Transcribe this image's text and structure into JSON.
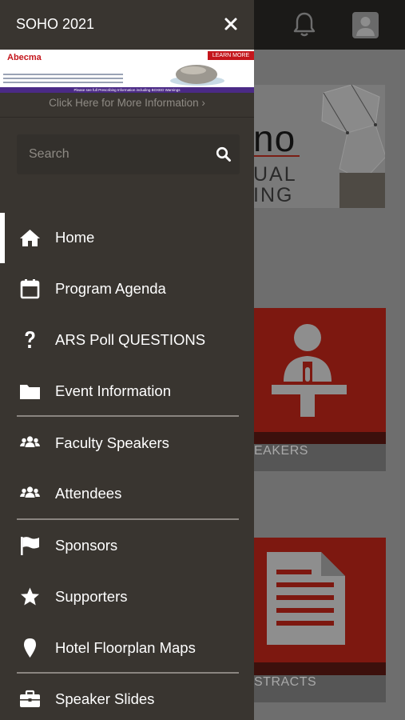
{
  "app_title": "SOHO 2021",
  "ad": {
    "brand": "Abecma",
    "cta": "LEARN MORE",
    "more_info": "Click Here for More Information ›",
    "footer": "Please see full Prescribing Information including BOXED Warnings"
  },
  "search": {
    "placeholder": "Search",
    "value": ""
  },
  "menu": [
    {
      "label": "Home",
      "icon": "home-icon",
      "active": true
    },
    {
      "label": "Program Agenda",
      "icon": "calendar-icon"
    },
    {
      "label": "ARS Poll QUESTIONS",
      "icon": "question-icon"
    },
    {
      "label": "Event Information",
      "icon": "folder-icon"
    },
    {
      "label": "Faculty Speakers",
      "icon": "users-icon"
    },
    {
      "label": "Attendees",
      "icon": "users-icon"
    },
    {
      "label": "Sponsors",
      "icon": "flag-icon"
    },
    {
      "label": "Supporters",
      "icon": "star-icon"
    },
    {
      "label": "Hotel Floorplan Maps",
      "icon": "map-pin-icon"
    },
    {
      "label": "Speaker Slides",
      "icon": "briefcase-icon"
    }
  ],
  "background": {
    "banner_title": "no",
    "banner_line1": "UAL",
    "banner_line2": "ING",
    "tiles": [
      {
        "label": "EAKERS"
      },
      {
        "label": "STRACTS"
      }
    ]
  },
  "colors": {
    "drawer_bg": "#393530",
    "tile_red": "#7d1810",
    "header_bg": "#1b1a18"
  }
}
